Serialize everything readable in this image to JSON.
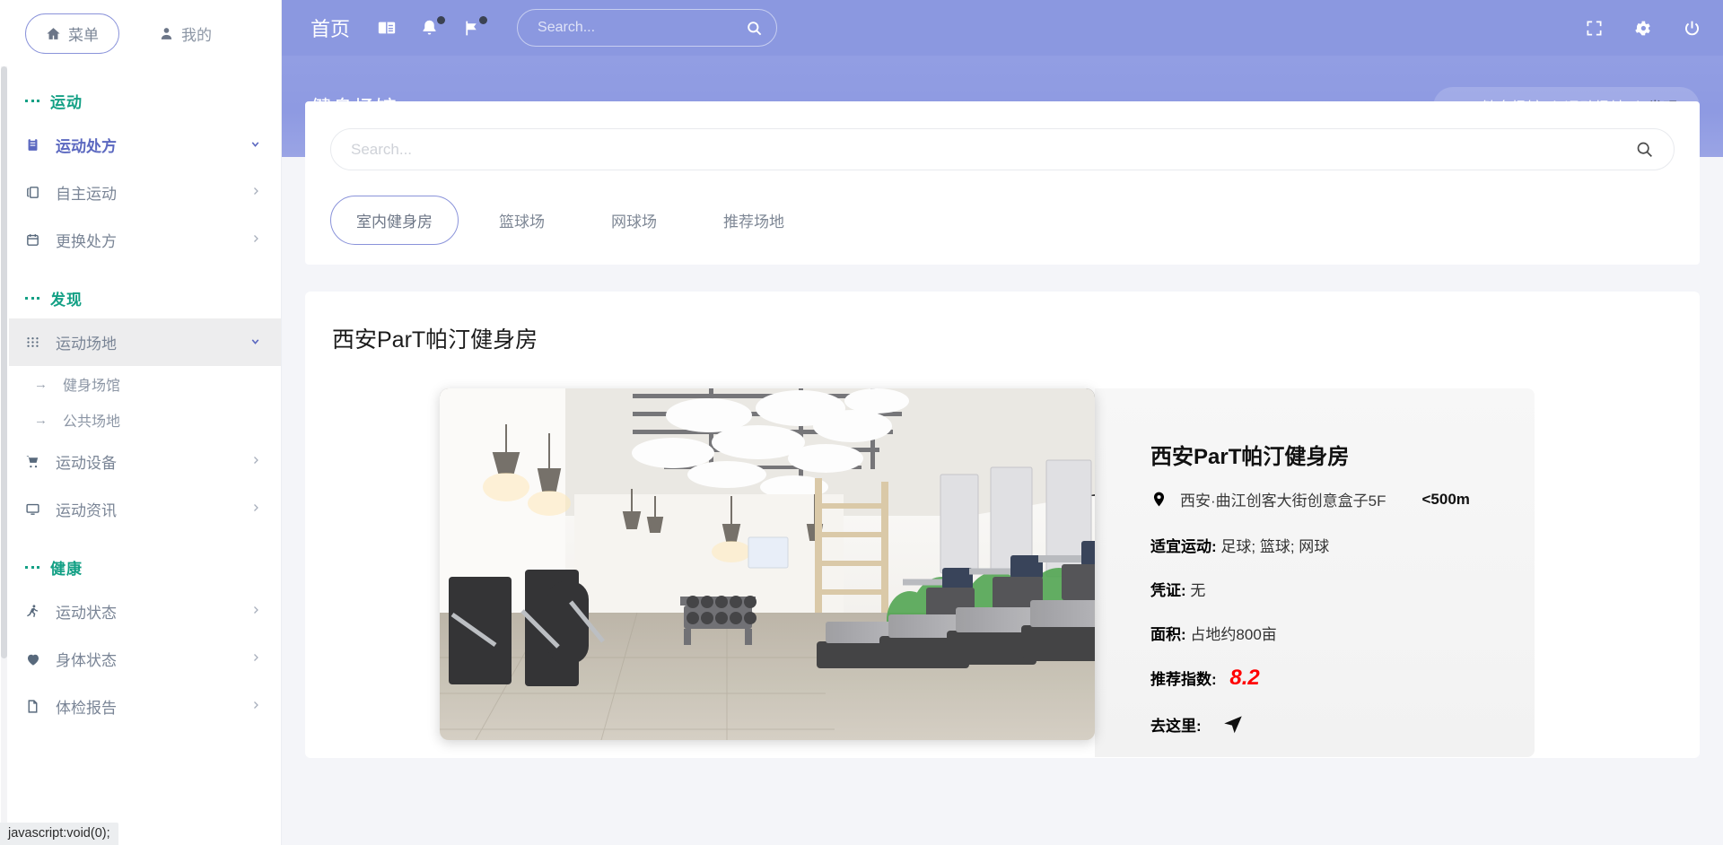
{
  "sidebar": {
    "tabs": [
      {
        "label": "菜单",
        "icon": "home-icon",
        "active": true
      },
      {
        "label": "我的",
        "icon": "user-icon",
        "active": false
      }
    ],
    "sections": [
      {
        "title": "运动",
        "items": [
          {
            "label": "运动处方",
            "icon": "clipboard-icon",
            "arrow": "chevron-down",
            "strong": true
          },
          {
            "label": "自主运动",
            "icon": "copy-icon",
            "arrow": "chevron-right",
            "strong": false
          },
          {
            "label": "更换处方",
            "icon": "calendar-icon",
            "arrow": "chevron-right",
            "strong": false
          }
        ]
      },
      {
        "title": "发现",
        "items": [
          {
            "label": "运动场地",
            "icon": "grid-icon",
            "arrow": "chevron-down",
            "active": true,
            "children": [
              {
                "label": "健身场馆"
              },
              {
                "label": "公共场地"
              }
            ]
          },
          {
            "label": "运动设备",
            "icon": "cart-icon",
            "arrow": "chevron-right"
          },
          {
            "label": "运动资讯",
            "icon": "monitor-icon",
            "arrow": "chevron-right"
          }
        ]
      },
      {
        "title": "健康",
        "items": [
          {
            "label": "运动状态",
            "icon": "running-icon",
            "arrow": "chevron-right"
          },
          {
            "label": "身体状态",
            "icon": "heart-icon",
            "arrow": "chevron-right"
          },
          {
            "label": "体检报告",
            "icon": "report-icon",
            "arrow": "chevron-right"
          }
        ]
      }
    ]
  },
  "topbar": {
    "home_label": "首页",
    "icons": [
      {
        "name": "book-icon",
        "badge": false
      },
      {
        "name": "bell-icon",
        "badge": true
      },
      {
        "name": "flag-icon",
        "badge": true
      }
    ],
    "search": {
      "value": "",
      "placeholder": "Search..."
    },
    "right_icons": [
      {
        "name": "fullscreen-icon"
      },
      {
        "name": "gear-icon"
      },
      {
        "name": "power-icon"
      }
    ]
  },
  "page": {
    "title": "健身场馆",
    "breadcrumb": [
      {
        "label": "健身场馆",
        "icon": "home-icon"
      },
      {
        "label": "运动场地"
      },
      {
        "label": "发现",
        "current": true
      }
    ],
    "breadcrumb_separator": "/"
  },
  "filter": {
    "search": {
      "value": "",
      "placeholder": "Search..."
    },
    "search_icon": "search-icon",
    "tabs": [
      {
        "label": "室内健身房",
        "active": true
      },
      {
        "label": "篮球场",
        "active": false
      },
      {
        "label": "网球场",
        "active": false
      },
      {
        "label": "推荐场地",
        "active": false
      }
    ]
  },
  "venue": {
    "section_title": "西安ParT帕汀健身房",
    "photo_alt": "indoor-gym-photo",
    "name": "西安ParT帕汀健身房",
    "address": "西安·曲江创客大街创意盒子5F",
    "distance": "<500m",
    "address_icon": "map-pin-icon",
    "fields": [
      {
        "label": "适宜运动:",
        "value": "足球; 篮球; 网球"
      },
      {
        "label": "凭证:",
        "value": "无"
      },
      {
        "label": "面积:",
        "value": "占地约800亩"
      }
    ],
    "rating_label": "推荐指数:",
    "rating_value": "8.2",
    "goto_label": "去这里:",
    "goto_icon": "navigation-cursor-icon"
  },
  "statusbar": {
    "text": "javascript:void(0);"
  },
  "colors": {
    "header": "#8b98e0",
    "accent_green": "#13a085",
    "accent_purple": "#5b68c0",
    "rating_red": "#ff0000"
  }
}
